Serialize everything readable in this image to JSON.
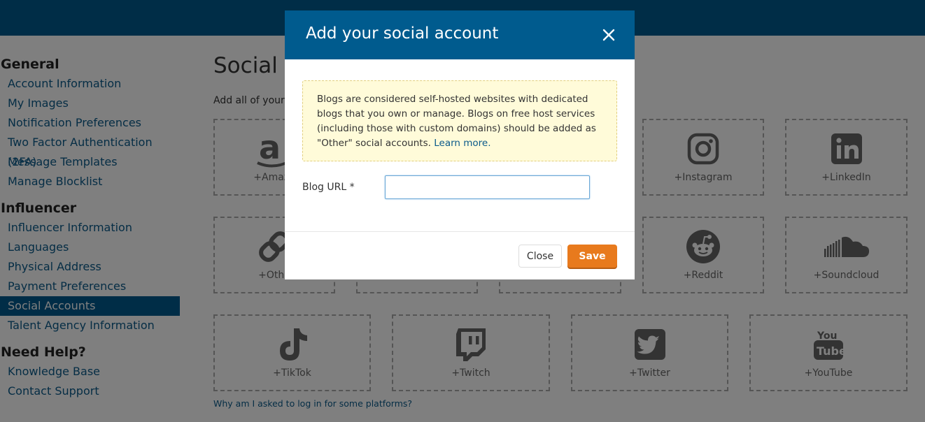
{
  "sidebar": {
    "sections": [
      {
        "title": "General",
        "items": [
          "Account Information",
          "My Images",
          "Notification Preferences",
          "Two Factor Authentication (2FA)",
          "Message Templates",
          "Manage Blocklist"
        ]
      },
      {
        "title": "Influencer",
        "items": [
          "Influencer Information",
          "Languages",
          "Physical Address",
          "Payment Preferences",
          "Social Accounts",
          "Talent Agency Information"
        ]
      },
      {
        "title": "Need Help?",
        "items": [
          "Knowledge Base",
          "Contact Support"
        ]
      }
    ],
    "active_item": "Social Accounts"
  },
  "main": {
    "title": "Social A",
    "intro": "Add all of your s"
  },
  "tiles": {
    "amazon": "+Amazo",
    "instagram": "+Instagram",
    "linkedin": "+LinkedIn",
    "other": "+Othe",
    "reddit": "+Reddit",
    "soundcloud": "+Soundcloud",
    "tiktok": "+TikTok",
    "twitch": "+Twitch",
    "twitter": "+Twitter",
    "youtube": "+YouTube"
  },
  "help_link": "Why am I asked to log in for some platforms?",
  "modal": {
    "title": "Add your social account",
    "notice_text": "Blogs are considered self-hosted websites with dedicated blogs that you own or manage. Blogs on free host services (including those with custom domains) should be added as \"Other\" social accounts.",
    "learn_more": "Learn more.",
    "field_label": "Blog URL *",
    "field_value": "",
    "close_label": "Close",
    "save_label": "Save"
  },
  "colors": {
    "brand": "#005b8e",
    "accent": "#e87a1d",
    "notice_bg": "#fffbd9",
    "link": "#0a5a8a"
  }
}
